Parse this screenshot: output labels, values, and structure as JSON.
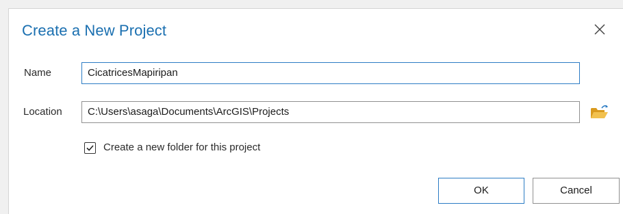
{
  "dialog": {
    "title": "Create a New Project",
    "close_icon": "close-icon"
  },
  "form": {
    "name_label": "Name",
    "name_value": "CicatricesMapiripan",
    "location_label": "Location",
    "location_value": "C:\\Users\\asaga\\Documents\\ArcGIS\\Projects",
    "browse_icon": "folder-open-icon",
    "create_folder_checked": true,
    "create_folder_label": "Create a new folder for this project"
  },
  "buttons": {
    "ok_label": "OK",
    "cancel_label": "Cancel"
  },
  "colors": {
    "title": "#1a6fb0",
    "accent_border": "#2a7bc4",
    "folder_icon": "#e8b030"
  }
}
